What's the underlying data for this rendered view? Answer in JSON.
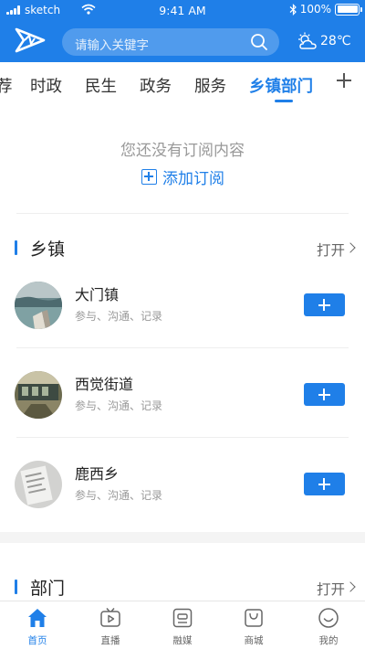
{
  "status_bar": {
    "carrier": "sketch",
    "time": "9:41 AM",
    "battery": "100%"
  },
  "header": {
    "search_placeholder": "请输入关键字",
    "temperature": "28℃",
    "accent_color": "#1f7fe8",
    "weather_icon": "partly-cloudy-icon"
  },
  "tabs": {
    "items": [
      "荐",
      "时政",
      "民生",
      "政务",
      "服务",
      "乡镇部门"
    ],
    "active_index": 5
  },
  "empty_state": {
    "message": "您还没有订阅内容",
    "action_label": "添加订阅"
  },
  "townships": {
    "title": "乡镇",
    "more_label": "打开",
    "items": [
      {
        "name": "大门镇",
        "desc": "参与、沟通、记录"
      },
      {
        "name": "西觉街道",
        "desc": "参与、沟通、记录"
      },
      {
        "name": "鹿西乡",
        "desc": "参与、沟通、记录"
      }
    ]
  },
  "departments": {
    "title": "部门",
    "more_label": "打开"
  },
  "bottom_nav": {
    "items": [
      {
        "label": "首页",
        "icon": "home-icon"
      },
      {
        "label": "直播",
        "icon": "tv-icon"
      },
      {
        "label": "融媒",
        "icon": "media-icon"
      },
      {
        "label": "商城",
        "icon": "shopping-bag-icon"
      },
      {
        "label": "我的",
        "icon": "smiley-icon"
      }
    ],
    "active_index": 0
  }
}
